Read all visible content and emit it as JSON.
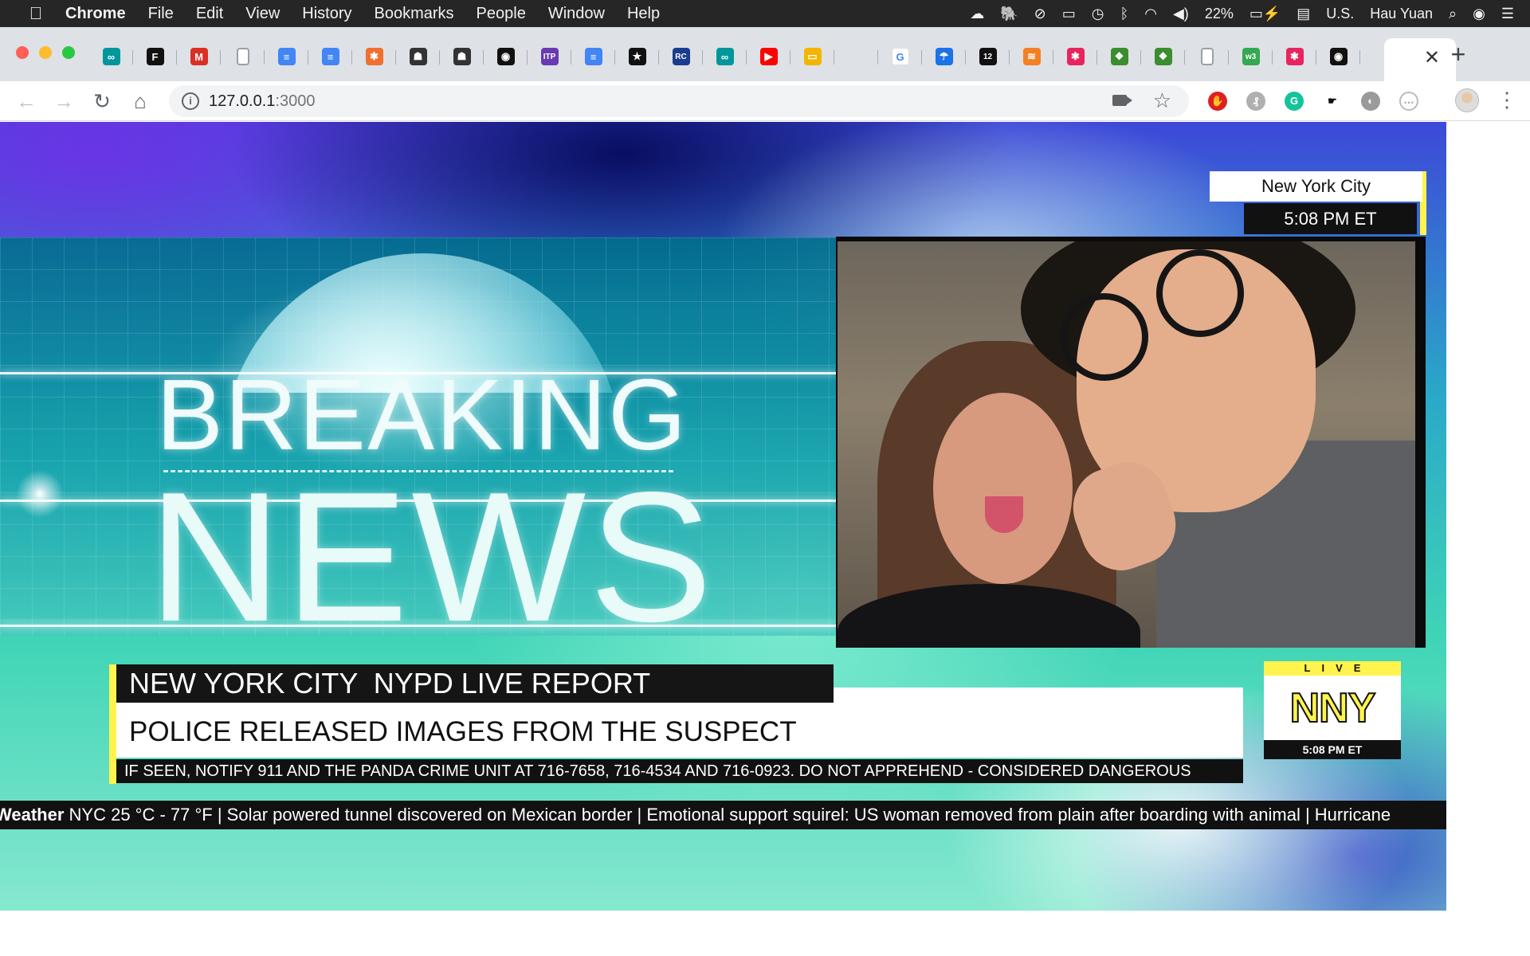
{
  "menubar": {
    "app": "Chrome",
    "items": [
      "File",
      "Edit",
      "View",
      "History",
      "Bookmarks",
      "People",
      "Window",
      "Help"
    ],
    "battery": "22%",
    "input_source": "U.S.",
    "user": "Hau Yuan"
  },
  "tabs": {
    "favicons": [
      {
        "icon": "arduino-icon",
        "color": "#00979c",
        "glyph": "∞"
      },
      {
        "icon": "framer-icon",
        "color": "#111111",
        "glyph": "F"
      },
      {
        "icon": "gmail-icon",
        "color": "#d93025",
        "glyph": "M"
      },
      {
        "icon": "page-icon",
        "color": "#9aa0a6",
        "glyph": ""
      },
      {
        "icon": "docs-icon",
        "color": "#4285f4",
        "glyph": "≡"
      },
      {
        "icon": "docs-icon",
        "color": "#4285f4",
        "glyph": "≡"
      },
      {
        "icon": "pinwheel-icon",
        "color": "#f07030",
        "glyph": "✱"
      },
      {
        "icon": "robot-icon",
        "color": "#333333",
        "glyph": "☗"
      },
      {
        "icon": "robot-icon",
        "color": "#333333",
        "glyph": "☗"
      },
      {
        "icon": "github-icon",
        "color": "#111111",
        "glyph": "◉"
      },
      {
        "icon": "itp-icon",
        "color": "#6a3ab2",
        "glyph": "ITP"
      },
      {
        "icon": "docs-icon",
        "color": "#4285f4",
        "glyph": "≡"
      },
      {
        "icon": "star-badge-icon",
        "color": "#111111",
        "glyph": "★"
      },
      {
        "icon": "rc-icon",
        "color": "#1a3d8f",
        "glyph": "RC"
      },
      {
        "icon": "arduino-icon",
        "color": "#00979c",
        "glyph": "∞"
      },
      {
        "icon": "youtube-icon",
        "color": "#ff0000",
        "glyph": "▶"
      },
      {
        "icon": "slides-icon",
        "color": "#f4b400",
        "glyph": "▭"
      },
      {
        "icon": "blank-icon",
        "color": "#dee1e6",
        "glyph": ""
      },
      {
        "icon": "google-icon",
        "color": "#ffffff",
        "glyph": "G"
      },
      {
        "icon": "umbrella-icon",
        "color": "#1a73e8",
        "glyph": "☂"
      },
      {
        "icon": "twelve-icon",
        "color": "#111111",
        "glyph": "12"
      },
      {
        "icon": "stackoverflow-icon",
        "color": "#f48024",
        "glyph": "≋"
      },
      {
        "icon": "asterisk-icon",
        "color": "#e8245e",
        "glyph": "✱"
      },
      {
        "icon": "extension-icon",
        "color": "#3c8d2f",
        "glyph": "❖"
      },
      {
        "icon": "extension-icon",
        "color": "#3c8d2f",
        "glyph": "❖"
      },
      {
        "icon": "page-icon",
        "color": "#9aa0a6",
        "glyph": ""
      },
      {
        "icon": "sheets-icon",
        "color": "#34a853",
        "glyph": "w3"
      },
      {
        "icon": "asterisk-icon",
        "color": "#e8245e",
        "glyph": "✱"
      },
      {
        "icon": "github-icon",
        "color": "#111111",
        "glyph": "◉"
      }
    ],
    "active_close": "✕",
    "new_tab": "+"
  },
  "toolbar": {
    "url_host": "127.0.0.1",
    "url_port": ":3000"
  },
  "broadcast": {
    "breaking": "BREAKING",
    "news": "NEWS",
    "location": "New York City",
    "time": "5:08 PM ET",
    "headline_top": "NEW YORK CITY  NYPD LIVE REPORT",
    "headline_main": "POLICE RELEASED IMAGES FROM THE SUSPECT",
    "headline_sub": "IF SEEN, NOTIFY 911 AND THE PANDA CRIME UNIT AT 716-7658, 716-4534 AND 716-0923. DO NOT APPREHEND - CONSIDERED DANGEROUS",
    "live_label": "LIVE",
    "logo": "NNY",
    "logo_time": "5:08 PM ET",
    "ticker_label": "Weather",
    "ticker_text": " NYC 25 °C - 77 °F |  Solar powered tunnel discovered on Mexican border | Emotional support squirel: US woman removed from plain after boarding with animal | Hurricane"
  },
  "colors": {
    "accent_yellow": "#fff34d",
    "bar_dark": "#111111"
  }
}
